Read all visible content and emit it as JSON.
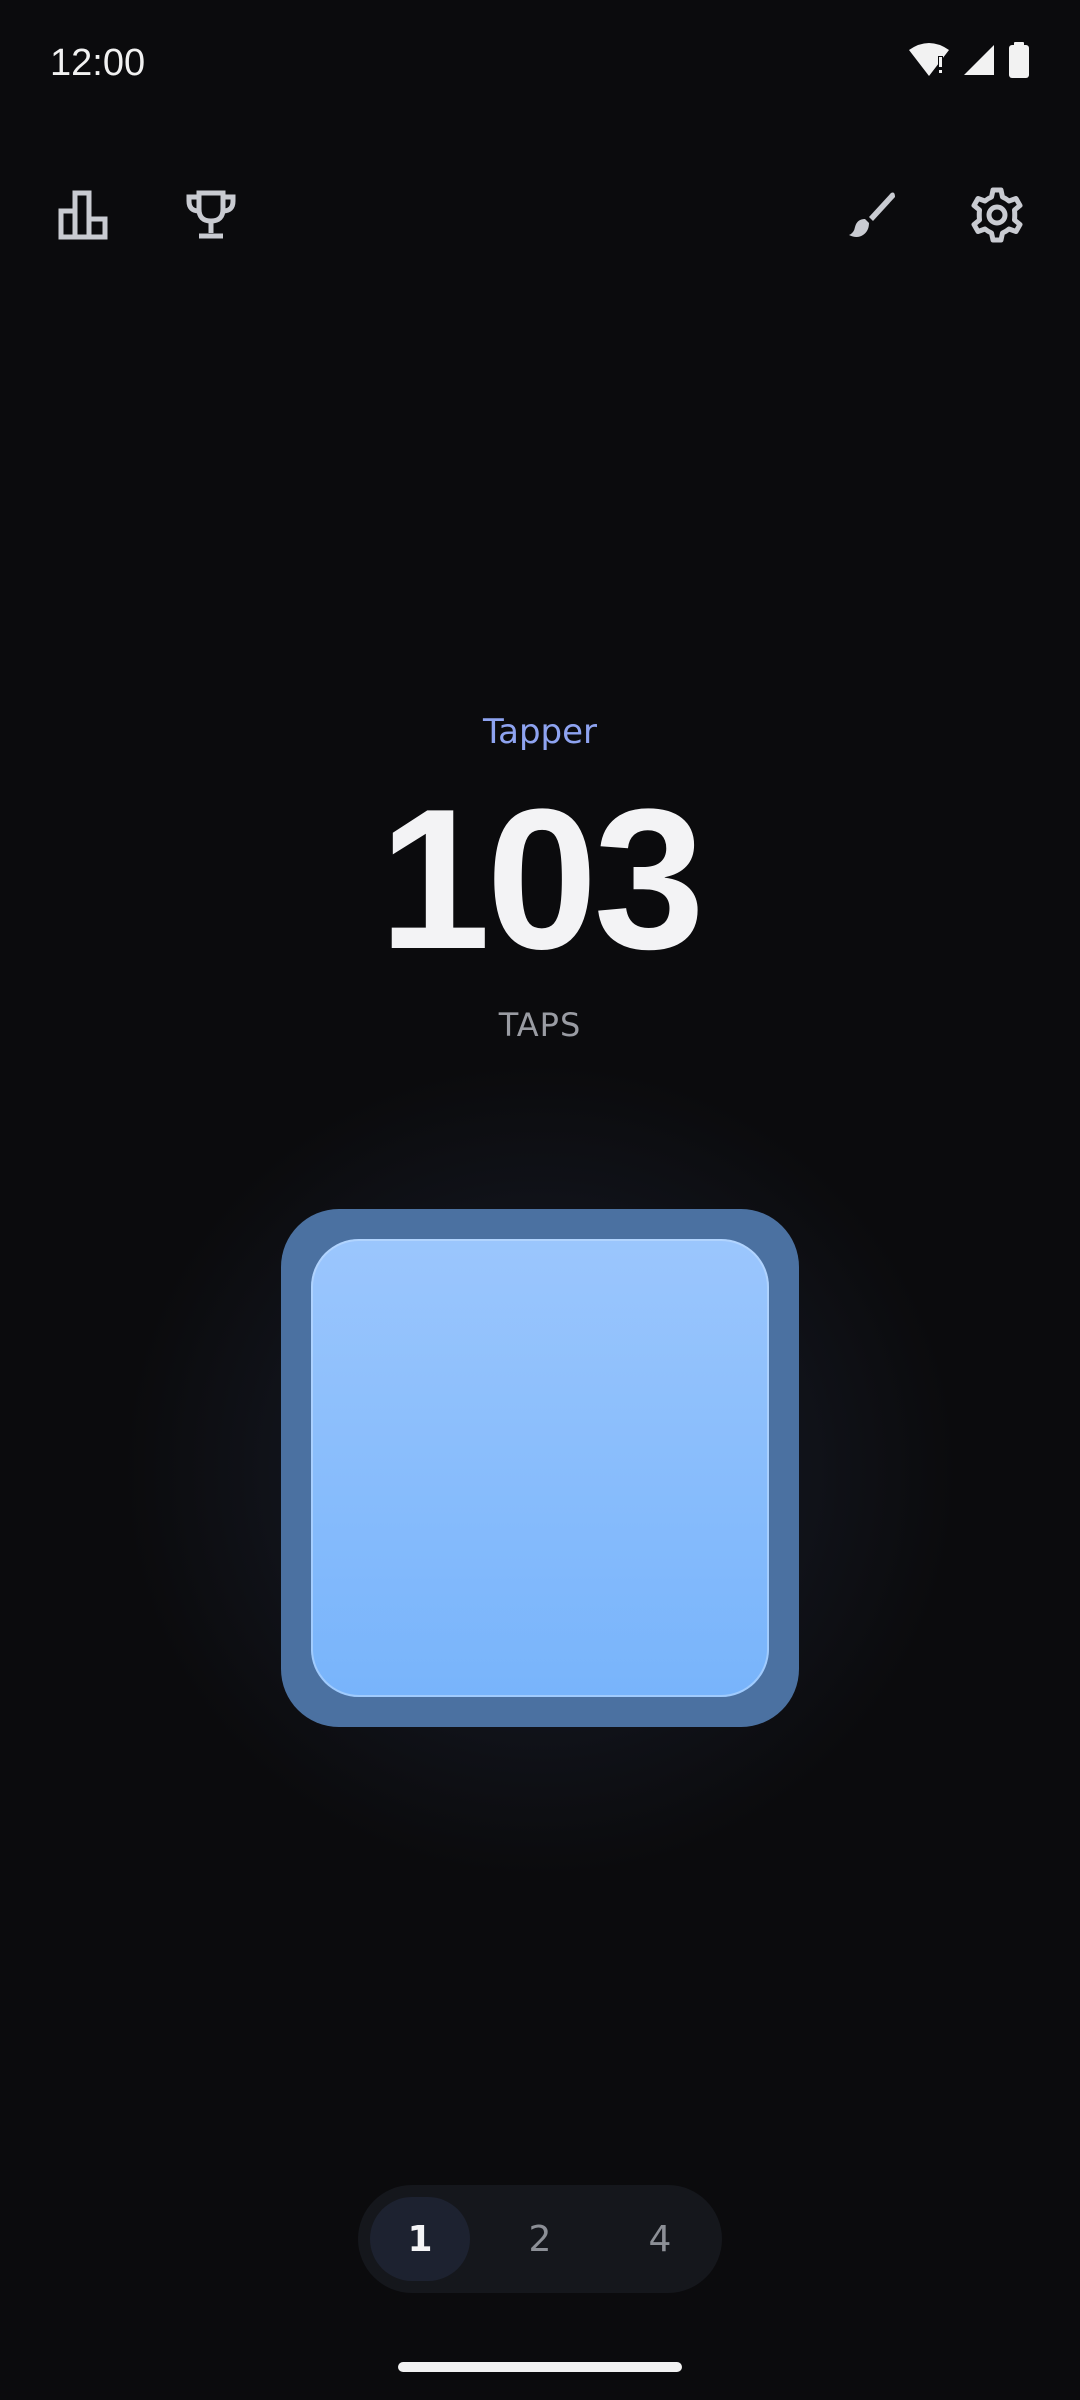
{
  "status_bar": {
    "time": "12:00",
    "icons": [
      "wifi-alert-icon",
      "cell-signal-icon",
      "battery-icon"
    ]
  },
  "toolbar": {
    "left": [
      "stats-icon",
      "trophy-icon"
    ],
    "right": [
      "brush-icon",
      "gear-icon"
    ]
  },
  "counter": {
    "mode_label": "Tapper",
    "count": "103",
    "unit": "TAPS"
  },
  "selector": {
    "options": [
      "1",
      "2",
      "4"
    ],
    "selected": "1"
  },
  "colors": {
    "background": "#0b0b0d",
    "accent_label": "#8ea3f0",
    "pad_outer": "#4b71a1",
    "pad_inner_top": "#9bc6fd",
    "pad_inner_bottom": "#78b4fb"
  }
}
